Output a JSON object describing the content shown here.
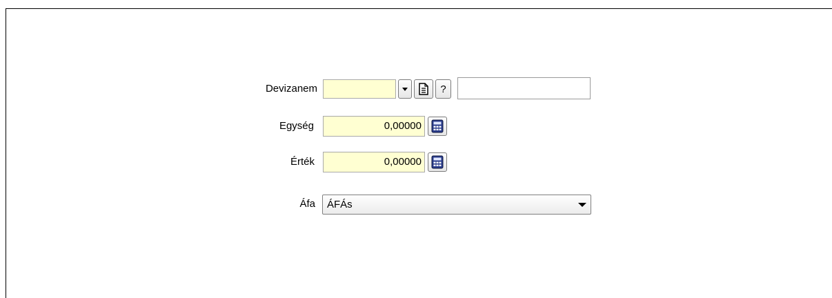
{
  "form": {
    "devizanem": {
      "label": "Devizanem",
      "value": "",
      "extra_value": ""
    },
    "egyseg": {
      "label": "Egység",
      "value": "0,00000"
    },
    "ertek": {
      "label": "Érték",
      "value": "0,00000"
    },
    "afa": {
      "label": "Áfa",
      "selected": "ÁFÁs"
    },
    "buttons": {
      "help": "?"
    }
  },
  "icons": [
    "chevron-down-icon",
    "document-icon",
    "help-icon",
    "calculator-icon",
    "dropdown-arrow-icon"
  ],
  "colors": {
    "input_bg": "#ffffd2",
    "border": "#a9a9a9"
  }
}
